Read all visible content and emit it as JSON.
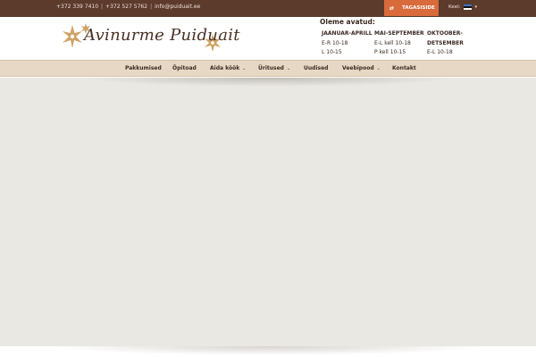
{
  "topbar": {
    "phone1": "+372 339 7410",
    "phone2": "+372 527 5762",
    "email": "info@puiduait.ee",
    "separator": "|",
    "feedback_label": "TAGASISIDE",
    "lang_label": "Keel:"
  },
  "brand": {
    "logo_text": "Avinurme Puiduait",
    "accent": "#d86a3b",
    "topbar_bg": "#5c3a2c",
    "nav_bg": "#e7d8c5"
  },
  "hours": {
    "title": "Oleme avatud:",
    "columns": [
      {
        "heading": "JAANUAR-APRILL",
        "lines": [
          "E-R 10-18",
          "L 10-15"
        ]
      },
      {
        "heading": "MAI-SEPTEMBER",
        "lines": [
          "E-L kell 10-18",
          "P kell 10-15"
        ]
      },
      {
        "heading": "OKTOOBER-",
        "lines": [
          "DETSEMBER",
          "E-L 10-18"
        ]
      }
    ]
  },
  "nav": {
    "items": [
      {
        "label": "Pakkumised"
      },
      {
        "label": "Õpitoad"
      },
      {
        "label": "Aida köök"
      },
      {
        "label": "Üritused"
      },
      {
        "label": "Uudised"
      },
      {
        "label": "Veebipood"
      },
      {
        "label": "Kontakt"
      }
    ]
  }
}
